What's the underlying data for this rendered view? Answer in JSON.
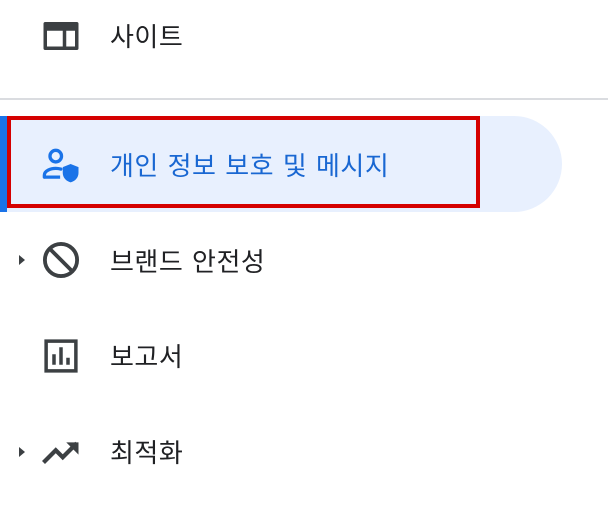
{
  "nav": {
    "items": [
      {
        "label": "사이트",
        "icon": "web-layout-icon"
      },
      {
        "label": "개인 정보 보호 및 메시지",
        "icon": "privacy-user-shield-icon",
        "active": true
      },
      {
        "label": "브랜드 안전성",
        "icon": "block-icon",
        "expandable": true
      },
      {
        "label": "보고서",
        "icon": "bar-chart-icon"
      },
      {
        "label": "최적화",
        "icon": "trending-up-icon",
        "expandable": true
      }
    ]
  },
  "colors": {
    "active_bg": "#e8f0fe",
    "active_text": "#1967d2",
    "active_bar": "#1a73e8",
    "highlight_border": "#d50000",
    "icon_gray": "#3c4043",
    "text": "#202124",
    "divider": "#dadce0"
  }
}
